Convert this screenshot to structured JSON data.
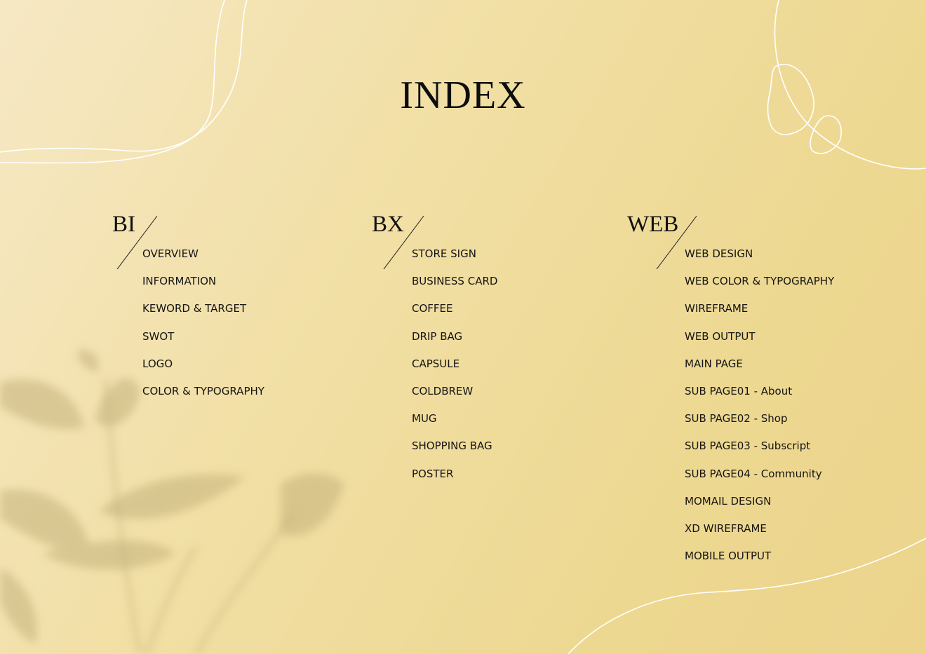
{
  "title": "INDEX",
  "sections": [
    {
      "heading": "BI",
      "items": [
        "OVERVIEW",
        "INFORMATION",
        "KEWORD & TARGET",
        "SWOT",
        "LOGO",
        "COLOR & TYPOGRAPHY"
      ]
    },
    {
      "heading": "BX",
      "items": [
        "STORE SIGN",
        "BUSINESS CARD",
        "COFFEE",
        "DRIP BAG",
        "CAPSULE",
        "COLDBREW",
        "MUG",
        "SHOPPING BAG",
        "POSTER"
      ]
    },
    {
      "heading": "WEB",
      "items": [
        "WEB DESIGN",
        "WEB COLOR & TYPOGRAPHY",
        "WIREFRAME",
        "WEB OUTPUT",
        "MAIN PAGE",
        "SUB PAGE01 - About",
        "SUB PAGE02 - Shop",
        "SUB PAGE03 - Subscript",
        "SUB PAGE04 - Community",
        "MOMAIL DESIGN",
        "XD WIREFRAME",
        "MOBILE OUTPUT"
      ]
    }
  ],
  "colors": {
    "background": "#f1dfa4",
    "text": "#111111",
    "line_art": "#ffffff",
    "leaf_shadow": "#cfc08a"
  },
  "decorations": [
    "line-art-curves",
    "leaf-shadow"
  ]
}
